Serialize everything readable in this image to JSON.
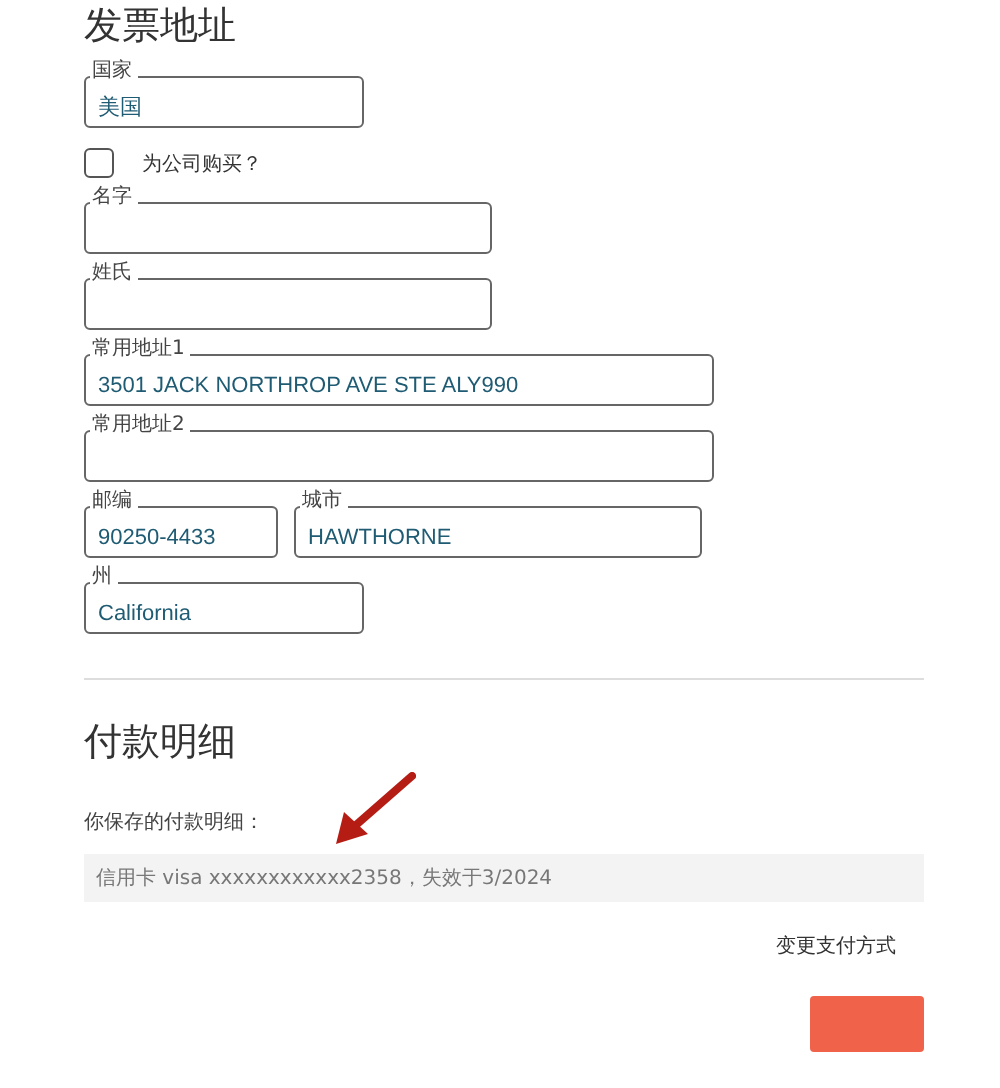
{
  "billing": {
    "title": "发票地址",
    "fields": [
      {
        "kind": "field",
        "label": "国家",
        "value": "美国"
      },
      {
        "kind": "checkbox",
        "label": "为公司购买？",
        "checked": false
      },
      {
        "kind": "field",
        "label": "名字"
      },
      {
        "kind": "field",
        "label": "姓氏"
      },
      {
        "kind": "field",
        "label": "常用地址1",
        "value": "3501 JACK NORTHROP AVE STE ALY990"
      },
      {
        "kind": "field",
        "label": "常用地址2"
      },
      {
        "kind": "pair",
        "items": [
          {
            "label": "邮编",
            "value": "90250-4433"
          },
          {
            "label": "城市",
            "value": "HAWTHORNE"
          }
        ]
      },
      {
        "kind": "field",
        "label": "州",
        "value": "California"
      }
    ]
  },
  "payment": {
    "title": "付款明细",
    "saved_label": "你保存的付款明细：",
    "saved_card": "信用卡 visa xxxxxxxxxxxx2358，失效于3/2024",
    "change_link": "变更支付方式"
  }
}
